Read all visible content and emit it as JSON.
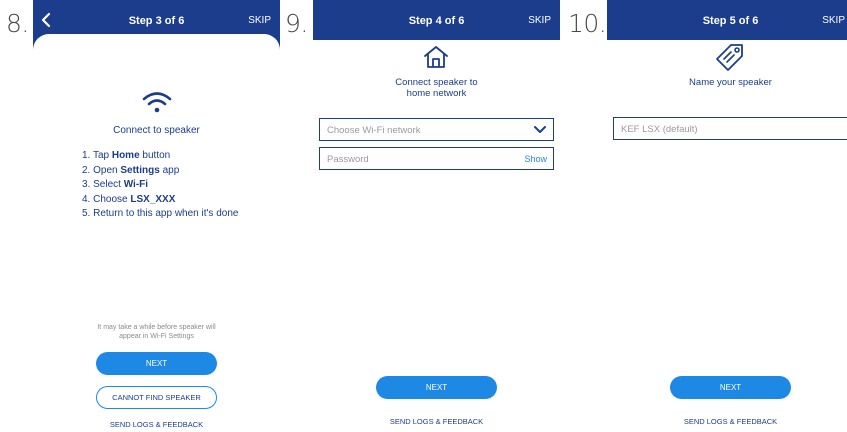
{
  "labels": {
    "a": "8.",
    "b": "9.",
    "c": "10."
  },
  "common": {
    "skip": "SKIP",
    "send_logs": "SEND LOGS & FEEDBACK",
    "next": "NEXT"
  },
  "step3": {
    "title": "Step 3 of 6",
    "heading": "Connect to speaker",
    "steps": [
      {
        "pre": "1. Tap ",
        "bold": "Home",
        "post": " button"
      },
      {
        "pre": "2. Open ",
        "bold": "Settings",
        "post": " app"
      },
      {
        "pre": "3. Select ",
        "bold": "Wi-Fi",
        "post": ""
      },
      {
        "pre": "4. Choose ",
        "bold": "LSX_XXX",
        "post": ""
      },
      {
        "pre": "5. Return to this app when it's done",
        "bold": "",
        "post": ""
      }
    ],
    "note_line1": "It may take a while before speaker will",
    "note_line2": "appear in Wi-Fi Settings",
    "cannot_find": "CANNOT FIND SPEAKER"
  },
  "step4": {
    "title": "Step 4 of 6",
    "heading_line1": "Connect speaker to",
    "heading_line2": "home network",
    "wifi_placeholder": "Choose Wi-Fi network",
    "password_placeholder": "Password",
    "show_label": "Show"
  },
  "step5": {
    "title": "Step 5 of 6",
    "heading": "Name your speaker",
    "name_placeholder": "KEF LSX (default)"
  },
  "colors": {
    "brand_navy": "#1c3d8c",
    "accent_blue": "#1e88e5"
  },
  "icons": [
    "back-arrow-icon",
    "wifi-icon",
    "home-icon",
    "chevron-down-icon",
    "tag-icon"
  ]
}
